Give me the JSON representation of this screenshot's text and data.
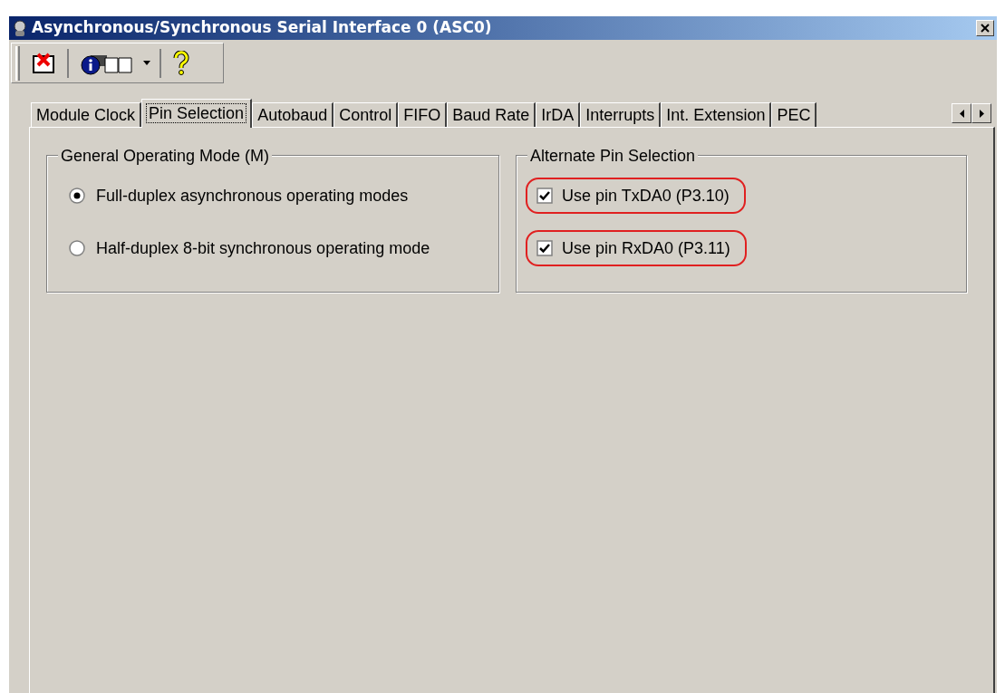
{
  "window": {
    "title": "Asynchronous/Synchronous Serial Interface 0 (ASC0)"
  },
  "tabs": [
    {
      "label": "Module Clock",
      "selected": false
    },
    {
      "label": "Pin Selection",
      "selected": true
    },
    {
      "label": "Autobaud",
      "selected": false
    },
    {
      "label": "Control",
      "selected": false
    },
    {
      "label": "FIFO",
      "selected": false
    },
    {
      "label": "Baud Rate",
      "selected": false
    },
    {
      "label": "IrDA",
      "selected": false
    },
    {
      "label": "Interrupts",
      "selected": false
    },
    {
      "label": "Int. Extension",
      "selected": false
    },
    {
      "label": "PEC",
      "selected": false
    }
  ],
  "operating_mode": {
    "title": "General Operating Mode (M)",
    "options": [
      {
        "label": "Full-duplex asynchronous operating modes",
        "selected": true
      },
      {
        "label": "Half-duplex 8-bit synchronous operating mode",
        "selected": false
      }
    ]
  },
  "pin_selection": {
    "title": "Alternate Pin Selection",
    "options": [
      {
        "label": "Use pin TxDA0 (P3.10)",
        "checked": true,
        "highlighted": true
      },
      {
        "label": "Use pin RxDA0 (P3.11)",
        "checked": true,
        "highlighted": true
      }
    ]
  }
}
